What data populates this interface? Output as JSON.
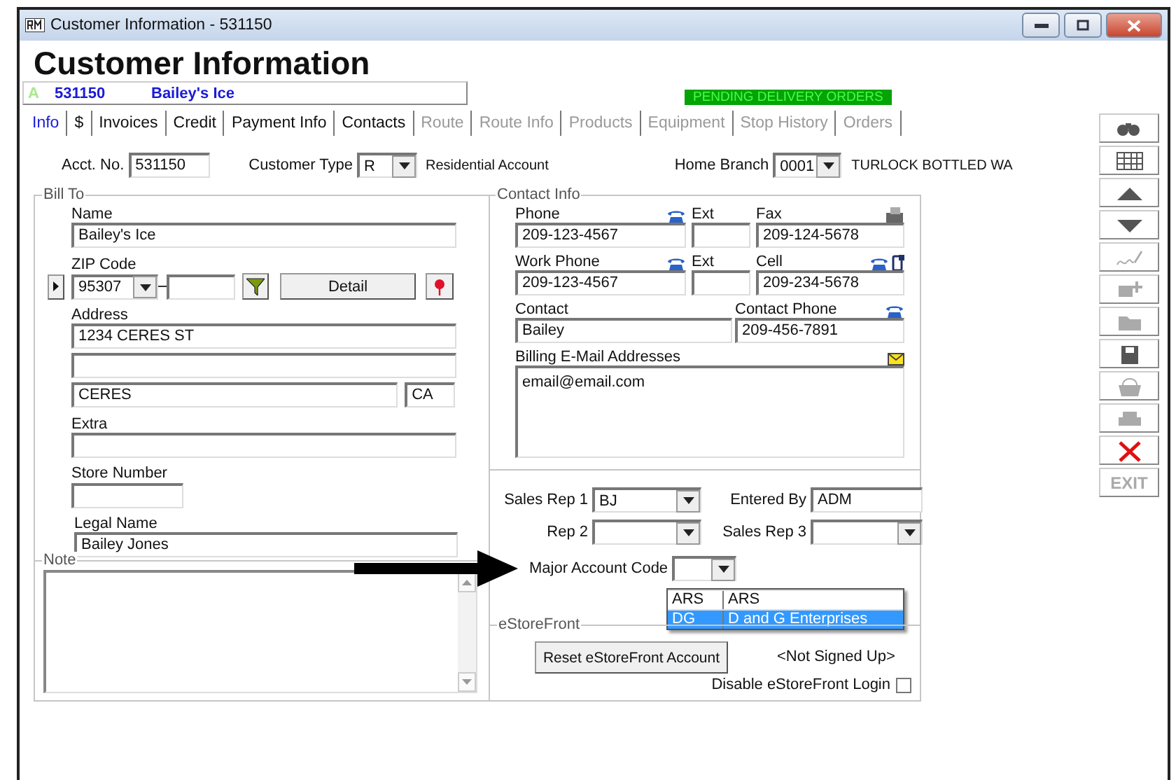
{
  "window": {
    "title": "Customer Information - 531150"
  },
  "header": {
    "title": "Customer Information",
    "status_letter": "A",
    "account": "531150",
    "name": "Bailey's Ice",
    "alert": "PENDING DELIVERY ORDERS"
  },
  "tabs": [
    {
      "label": "Info",
      "selected": true,
      "disabled": false
    },
    {
      "label": "$",
      "selected": false,
      "disabled": false
    },
    {
      "label": "Invoices",
      "selected": false,
      "disabled": false
    },
    {
      "label": "Credit",
      "selected": false,
      "disabled": false
    },
    {
      "label": "Payment Info",
      "selected": false,
      "disabled": false
    },
    {
      "label": "Contacts",
      "selected": false,
      "disabled": false
    },
    {
      "label": "Route",
      "selected": false,
      "disabled": true
    },
    {
      "label": "Route Info",
      "selected": false,
      "disabled": true
    },
    {
      "label": "Products",
      "selected": false,
      "disabled": true
    },
    {
      "label": "Equipment",
      "selected": false,
      "disabled": true
    },
    {
      "label": "Stop History",
      "selected": false,
      "disabled": true
    },
    {
      "label": "Orders",
      "selected": false,
      "disabled": true
    }
  ],
  "account_row": {
    "acct_label": "Acct. No.",
    "acct_value": "531150",
    "type_label": "Customer Type",
    "type_value": "R",
    "type_desc": "Residential Account",
    "branch_label": "Home Branch",
    "branch_value": "0001",
    "branch_desc": "TURLOCK BOTTLED WA"
  },
  "bill_to": {
    "legend": "Bill To",
    "name_label": "Name",
    "name": "Bailey's Ice",
    "zip_label": "ZIP Code",
    "zip": "95307",
    "detail_button": "Detail",
    "address_label": "Address",
    "address1": "1234 CERES ST",
    "city": "CERES",
    "state": "CA",
    "extra_label": "Extra",
    "store_label": "Store Number",
    "legal_label": "Legal Name",
    "legal_name": "Bailey Jones"
  },
  "note": {
    "legend": "Note"
  },
  "contact": {
    "legend": "Contact Info",
    "phone_label": "Phone",
    "phone": "209-123-4567",
    "ext_label": "Ext",
    "fax_label": "Fax",
    "fax": "209-124-5678",
    "work_label": "Work Phone",
    "work_phone": "209-123-4567",
    "work_ext_label": "Ext",
    "cell_label": "Cell",
    "cell": "209-234-5678",
    "contact_label": "Contact",
    "contact": "Bailey",
    "contact_phone_label": "Contact Phone",
    "contact_phone": "209-456-7891",
    "email_label": "Billing E-Mail Addresses",
    "email": "email@email.com"
  },
  "sales": {
    "rep1_label": "Sales Rep 1",
    "rep1": "BJ",
    "entered_label": "Entered By",
    "entered": "ADM",
    "rep2_label": "Rep 2",
    "rep3_label": "Sales Rep 3",
    "major_label": "Major Account Code",
    "options": [
      {
        "code": "ARS",
        "name": "ARS",
        "selected": false
      },
      {
        "code": "DG",
        "name": "D and G Enterprises",
        "selected": true
      }
    ]
  },
  "estorefront": {
    "legend": "eStoreFront",
    "reset_button": "Reset eStoreFront Account",
    "status": "<Not Signed Up>",
    "disable_label": "Disable eStoreFront Login",
    "disable_checked": false
  },
  "toolbar": [
    {
      "kind": "find",
      "disabled": false
    },
    {
      "kind": "grid",
      "disabled": false
    },
    {
      "kind": "up",
      "disabled": false
    },
    {
      "kind": "down",
      "disabled": false
    },
    {
      "kind": "sign",
      "disabled": true
    },
    {
      "kind": "add",
      "disabled": true
    },
    {
      "kind": "folder",
      "disabled": true
    },
    {
      "kind": "save",
      "disabled": false
    },
    {
      "kind": "basket",
      "disabled": true
    },
    {
      "kind": "print",
      "disabled": true
    },
    {
      "kind": "close",
      "disabled": false
    },
    {
      "kind": "text",
      "label": "EXIT",
      "disabled": true
    }
  ]
}
